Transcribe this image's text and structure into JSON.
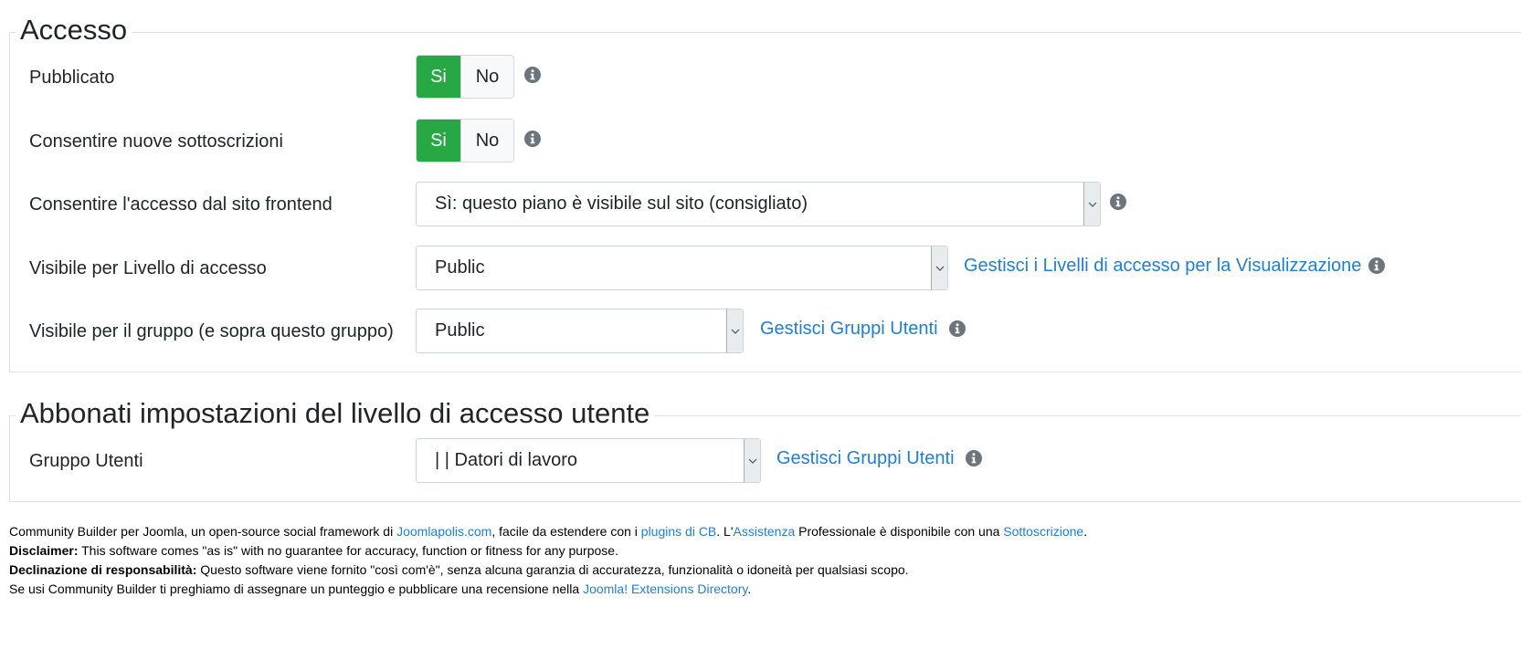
{
  "access_section": {
    "title": "Accesso",
    "published": {
      "label": "Pubblicato",
      "yes": "Si",
      "no": "No",
      "selected": "Si"
    },
    "allow_new_subscriptions": {
      "label": "Consentire nuove sottoscrizioni",
      "yes": "Si",
      "no": "No",
      "selected": "Si"
    },
    "frontend_access": {
      "label": "Consentire l'accesso dal sito frontend",
      "value": "Sì: questo piano è visibile sul sito (consigliato)"
    },
    "view_access_level": {
      "label": "Visibile per Livello di accesso",
      "value": "Public",
      "link": "Gestisci i Livelli di accesso per la Visualizzazione"
    },
    "visible_group": {
      "label": "Visibile per il gruppo (e sopra questo gruppo)",
      "value": "Public",
      "link": "Gestisci Gruppi Utenti"
    }
  },
  "subscriber_section": {
    "title": "Abbonati impostazioni del livello di accesso utente",
    "user_group": {
      "label": "Gruppo Utenti",
      "value": "| | Datori di lavoro",
      "link": "Gestisci Gruppi Utenti"
    }
  },
  "footer": {
    "line1": {
      "text_a": "Community Builder per Joomla, un open-source social framework di ",
      "link_joomlapolis": "Joomlapolis.com",
      "text_b": ", facile da estendere con i ",
      "link_plugins": "plugins di CB",
      "text_c": ". L'",
      "link_support": "Assistenza",
      "text_d": " Professionale è disponibile con una ",
      "link_subscription": "Sottoscrizione",
      "text_e": "."
    },
    "line2": {
      "label": "Disclaimer:",
      "text": " This software comes \"as is\" with no guarantee for accuracy, function or fitness for any purpose."
    },
    "line3": {
      "label": "Declinazione di responsabilità:",
      "text": " Questo software viene fornito \"così com'è\", senza alcuna garanzia di accuratezza, funzionalità o idoneità per qualsiasi scopo."
    },
    "line4": {
      "text_a": "Se usi Community Builder ti preghiamo di assegnare un punteggio e pubblicare una recensione nella ",
      "link_jed": "Joomla! Extensions Directory",
      "text_b": "."
    }
  },
  "colors": {
    "toggle_active": "#28a745",
    "link": "#1e7fd7",
    "info_icon": "#6c757d"
  },
  "icons": {
    "info": "info-circle-icon",
    "select_arrow": "chevron-down-icon"
  }
}
